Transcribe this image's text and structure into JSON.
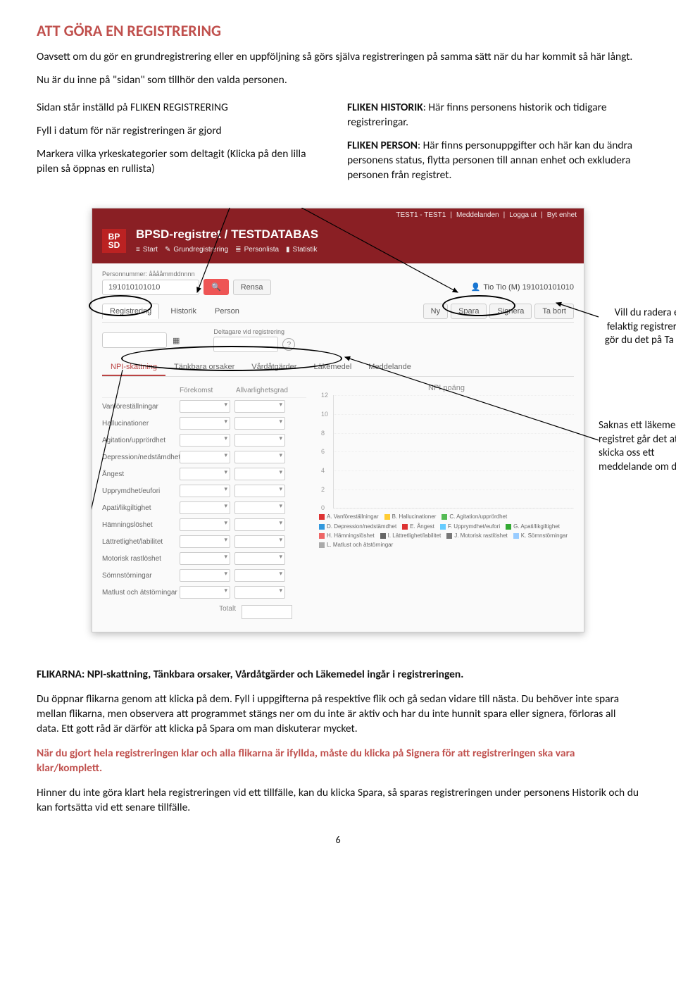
{
  "heading": "ATT GÖRA EN REGISTRERING",
  "intro1": "Oavsett om du gör en grundregistrering eller en uppföljning så görs själva registreringen på samma sätt när du har kommit så här långt.",
  "intro2": "Nu är du inne på \"sidan\" som tillhör den valda personen.",
  "leftcol": {
    "l1": "Sidan står inställd på FLIKEN REGISTRERING",
    "l2": "Fyll i datum för när registreringen är gjord",
    "l3": "Markera vilka yrkeskategorier som deltagit (Klicka på den lilla pilen så öppnas en rullista)"
  },
  "rightcol": {
    "r1a": "FLIKEN HISTORIK",
    "r1b": ": Här finns personens historik och tidigare registreringar.",
    "r2a": "FLIKEN PERSON",
    "r2b": ": Här finns personuppgifter och här kan du ändra personens status, flytta personen till annan enhet och exkludera personen från registret."
  },
  "note1": "Vill du radera en felaktig registrering, gör du det på Ta bort",
  "note2": "Saknas ett läkemedel i registret går det att skicka oss ett meddelande om detta.",
  "app": {
    "topbar": [
      "TEST1 - TEST1",
      "Meddelanden",
      "Logga ut",
      "Byt enhet"
    ],
    "title": "BPSD-registret / TESTDATABAS",
    "logo1": "BP",
    "logo2": "SD",
    "menu": [
      "Start",
      "Grundregistrering",
      "Personlista",
      "Statistik"
    ],
    "pn_label": "Personnummer: ååååmmddnnnn",
    "pn_value": "191010101010",
    "rensa": "Rensa",
    "person_name": "Tio Tio (M) 191010101010",
    "tabs": [
      "Registrering",
      "Historik",
      "Person"
    ],
    "actions": [
      "Ny",
      "Spara",
      "Signera",
      "Ta bort"
    ],
    "delt_label": "Deltagare vid registrering",
    "subtabs": [
      "NPI-skattning",
      "Tänkbara orsaker",
      "Vårdåtgärder",
      "Läkemedel",
      "Meddelande"
    ],
    "npi_head": [
      "",
      "Förekomst",
      "Allvarlighetsgrad"
    ],
    "npi_rows": [
      "Vanföreställningar",
      "Hallucinationer",
      "Agitation/upprördhet",
      "Depression/nedstämdhet",
      "Ångest",
      "Upprymdhet/eufori",
      "Apati/likgiltighet",
      "Hämningslöshet",
      "Lättretlighet/labilitet",
      "Motorisk rastlöshet",
      "Sömnstörningar",
      "Matlust och ätstörningar"
    ],
    "totalt": "Totalt",
    "chart_title": "NPI poäng",
    "legend": [
      "A. Vanföreställningar",
      "B. Hallucinationer",
      "C. Agitation/upprördhet",
      "D. Depression/nedstämdhet",
      "E. Ångest",
      "F. Upprymdhet/eufori",
      "G. Apati/likgiltighet",
      "H. Hämningslöshet",
      "I. Lättretlighet/labilitet",
      "J. Motorisk rastlöshet",
      "K. Sömnstörningar",
      "L. Matlust och ätstörningar"
    ],
    "legend_colors": [
      "#d33",
      "#fc3",
      "#5b5",
      "#39d",
      "#d33",
      "#6cf",
      "#3a3",
      "#e66",
      "#666",
      "#777",
      "#9cf",
      "#aaa"
    ]
  },
  "chart_data": {
    "type": "bar",
    "title": "NPI poäng",
    "xlabel": "",
    "ylabel": "",
    "ylim": [
      0,
      12
    ],
    "yticks": [
      0,
      2,
      4,
      6,
      8,
      10,
      12
    ],
    "categories": [
      "A",
      "B",
      "C",
      "D",
      "E",
      "F",
      "G",
      "H",
      "I",
      "J",
      "K",
      "L"
    ],
    "values": [
      0,
      0,
      0,
      0,
      0,
      0,
      0,
      0,
      0,
      0,
      0,
      0
    ]
  },
  "footer": {
    "f1a": "FLIKARNA: NPI-skattning, Tänkbara orsaker, Vårdåtgärder och Läkemedel ingår i registreringen.",
    "f2": "Du öppnar flikarna genom att klicka på dem. Fyll i uppgifterna på respektive flik och gå sedan vidare till nästa. Du behöver inte spara mellan flikarna, men observera att programmet stängs ner om du inte är aktiv och har du inte hunnit spara eller signera, förloras all data. Ett gott råd är därför att klicka på Spara om man diskuterar mycket.",
    "f3": "När du gjort hela registreringen klar och alla flikarna är ifyllda, måste du klicka på Signera för att registreringen ska vara klar/komplett.",
    "f4": "Hinner du inte göra klart hela registreringen vid ett tillfälle, kan du klicka Spara, så sparas registreringen under personens Historik och du kan fortsätta vid ett senare tillfälle."
  },
  "pagenum": "6"
}
